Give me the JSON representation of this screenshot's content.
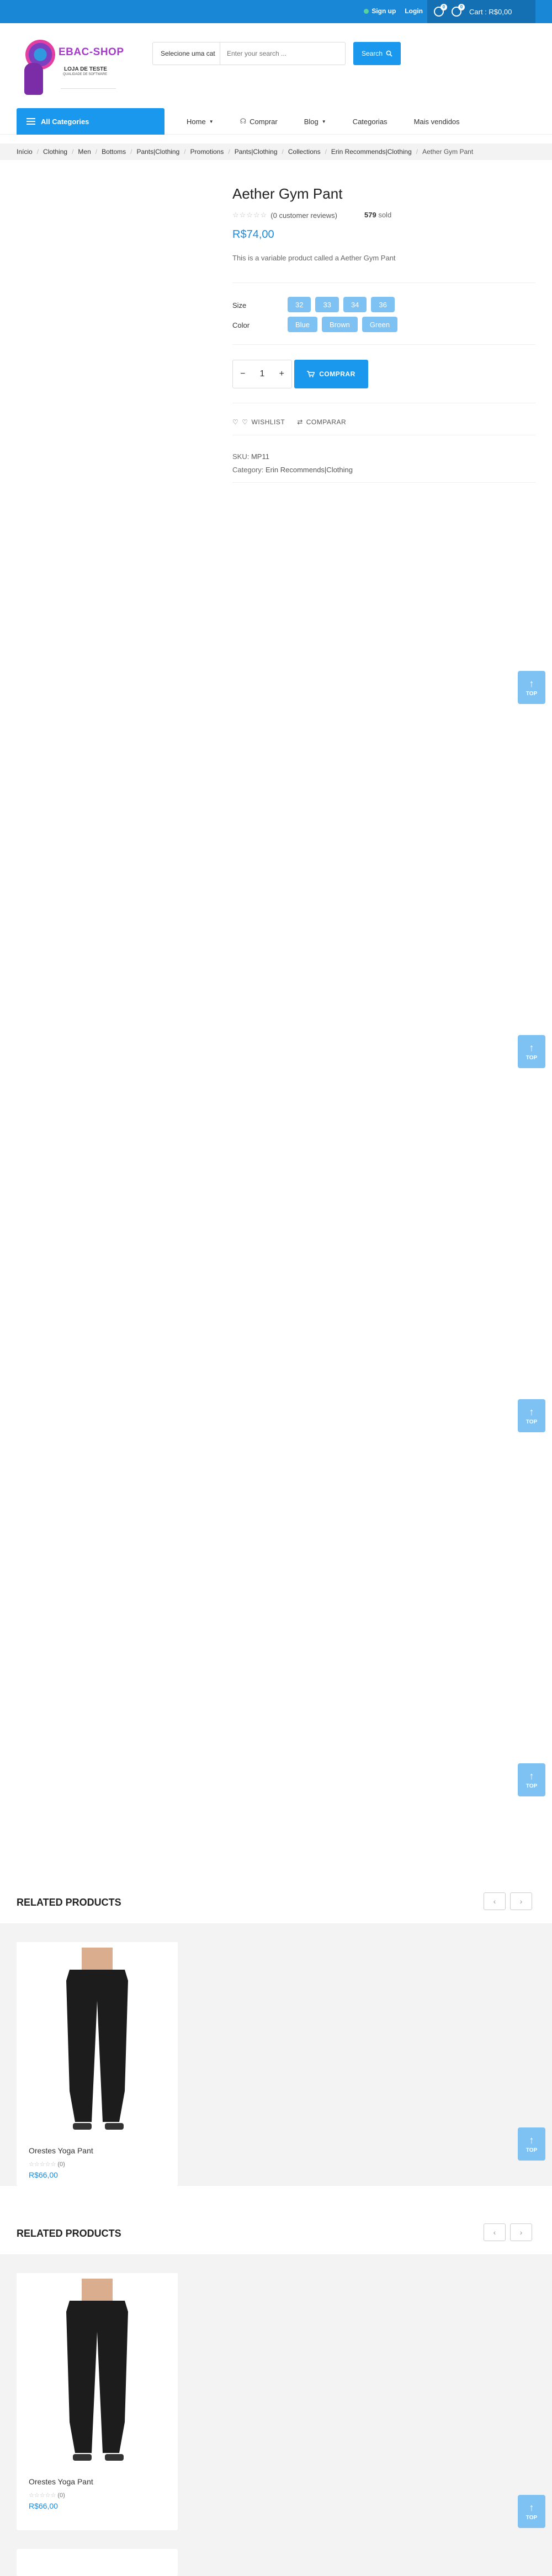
{
  "topbar": {
    "signup": "Sign up",
    "login": "Login",
    "cart_label": "Cart : R$0,00",
    "wishlist_count": "0",
    "cart_count": "0"
  },
  "header": {
    "brand": "EBAC-SHOP",
    "tagline": "LOJA DE TESTE",
    "tagline_small": "QUALIDADE DE SOFTWARE",
    "category_select": "Selecione uma cat",
    "search_placeholder": "Enter your search ...",
    "search_button": "Search"
  },
  "nav": {
    "all_categories": "All Categories",
    "items": [
      "Home",
      "Comprar",
      "Blog",
      "Categorias",
      "Mais vendidos"
    ]
  },
  "breadcrumb": [
    "Início",
    "Clothing",
    "Men",
    "Bottoms",
    "Pants|Clothing",
    "Promotions",
    "Pants|Clothing",
    "Collections",
    "Erin Recommends|Clothing",
    "Aether Gym Pant"
  ],
  "product": {
    "title": "Aether Gym Pant",
    "stars": "☆☆☆☆☆",
    "reviews": "(0 customer reviews)",
    "sold_count": "579",
    "sold_label": "sold",
    "price": "R$74,00",
    "description": "This is a variable product called a Aether Gym Pant",
    "size_label": "Size",
    "sizes": [
      "32",
      "33",
      "34",
      "36"
    ],
    "color_label": "Color",
    "colors": [
      "Blue",
      "Brown",
      "Green"
    ],
    "quantity": "1",
    "buy_button": "COMPRAR",
    "wishlist": "WISHLIST",
    "compare": "COMPARAR",
    "sku_label": "SKU:",
    "sku": "MP11",
    "category_label": "Category:",
    "category": "Erin Recommends|Clothing"
  },
  "top_button": "TOP",
  "related": {
    "heading": "RELATED PRODUCTS",
    "product_name": "Orestes Yoga Pant",
    "stars": "☆☆☆☆☆",
    "reviews": "(0)",
    "price": "R$66,00"
  },
  "colors": {
    "primary": "#1a98ee",
    "topbar": "#1a86d6",
    "chip": "#7dc2f2",
    "price": "#1a8be0"
  }
}
